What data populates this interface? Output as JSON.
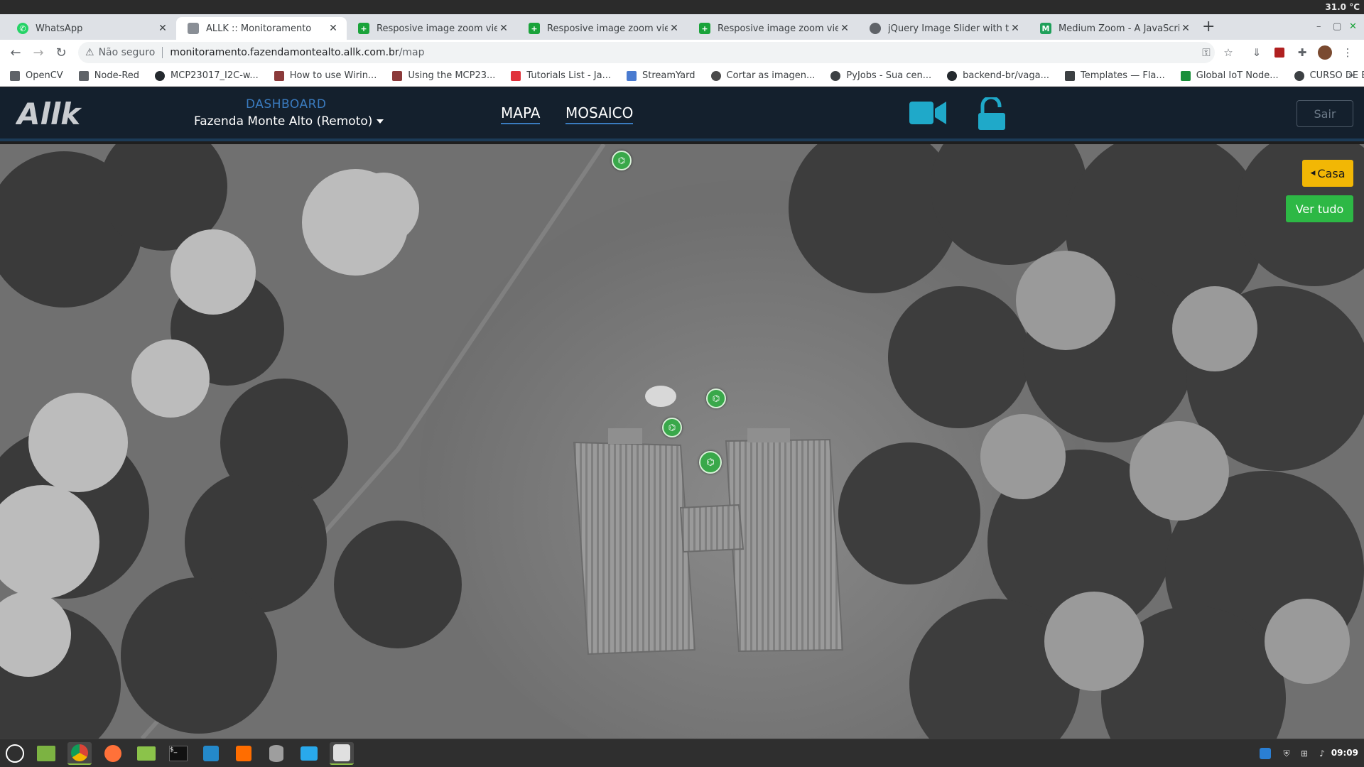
{
  "os": {
    "temperature": "31.0 °C",
    "clock": "09:09"
  },
  "browser": {
    "tabs": [
      {
        "title": "WhatsApp",
        "favicon": "whatsapp-icon",
        "color": "#25d366",
        "active": false
      },
      {
        "title": "ALLK :: Monitoramento",
        "favicon": "allk-icon",
        "color": "#8a8f96",
        "active": true
      },
      {
        "title": "Resposive image zoom viewer",
        "favicon": "plus-green-icon",
        "color": "#1aa33a",
        "active": false
      },
      {
        "title": "Resposive image zoom viewer",
        "favicon": "plus-green-icon",
        "color": "#1aa33a",
        "active": false
      },
      {
        "title": "Resposive image zoom viewer",
        "favicon": "plus-green-icon",
        "color": "#1aa33a",
        "active": false
      },
      {
        "title": "jQuery Image Slider with touch",
        "favicon": "globe-icon",
        "color": "#5f6368",
        "active": false
      },
      {
        "title": "Medium Zoom - A JavaScript library",
        "favicon": "medium-icon",
        "color": "#1fa05a",
        "active": false
      }
    ],
    "address": {
      "security": "Não seguro",
      "host": "monitoramento.fazendamontealto.allk.com.br",
      "path": "/map"
    },
    "bookmarks": [
      {
        "label": "OpenCV",
        "icon": "folder-icon",
        "color": "#5f6368"
      },
      {
        "label": "Node-Red",
        "icon": "folder-icon",
        "color": "#5f6368"
      },
      {
        "label": "MCP23017_I2C-w...",
        "icon": "github-icon",
        "color": "#24292e"
      },
      {
        "label": "How to use Wirin...",
        "icon": "site-icon",
        "color": "#8b3a3a"
      },
      {
        "label": "Using the MCP23...",
        "icon": "site-icon",
        "color": "#8b3a3a"
      },
      {
        "label": "Tutorials List - Ja...",
        "icon": "tutorials-icon",
        "color": "#e0313a"
      },
      {
        "label": "StreamYard",
        "icon": "streamyard-icon",
        "color": "#4a7bd0"
      },
      {
        "label": "Cortar as imagen...",
        "icon": "site-icon",
        "color": "#4a4a4a"
      },
      {
        "label": "PyJobs - Sua cen...",
        "icon": "globe-icon",
        "color": "#3c4043"
      },
      {
        "label": "backend-br/vaga...",
        "icon": "github-icon",
        "color": "#24292e"
      },
      {
        "label": "Templates — Fla...",
        "icon": "flask-icon",
        "color": "#3c4043"
      },
      {
        "label": "Global IoT Node...",
        "icon": "sigma-icon",
        "color": "#1a8f3a"
      },
      {
        "label": "CURSO DE ELETR...",
        "icon": "globe-icon",
        "color": "#3c4043"
      }
    ]
  },
  "app": {
    "logo": "Allk",
    "dashboard_label": "DASHBOARD",
    "farm": "Fazenda Monte Alto (Remoto)",
    "nav": {
      "map": "MAPA",
      "mosaic": "MOSAICO"
    },
    "accent": "#1fa9c9",
    "logout": "Sair"
  },
  "map": {
    "home_button": "Casa",
    "view_all_button": "Ver tudo",
    "camera_markers": [
      {
        "name": "camera-marker-north"
      },
      {
        "name": "camera-marker-house-center"
      },
      {
        "name": "camera-marker-house-left"
      },
      {
        "name": "camera-marker-house-south"
      }
    ]
  },
  "taskbar": {
    "apps": [
      "mint-menu-icon",
      "files-icon",
      "chrome-icon",
      "firefox-icon",
      "folder-icon",
      "terminal-icon",
      "vscode-icon",
      "sublime-icon",
      "database-icon",
      "telegram-icon",
      "inkscape-icon"
    ]
  }
}
